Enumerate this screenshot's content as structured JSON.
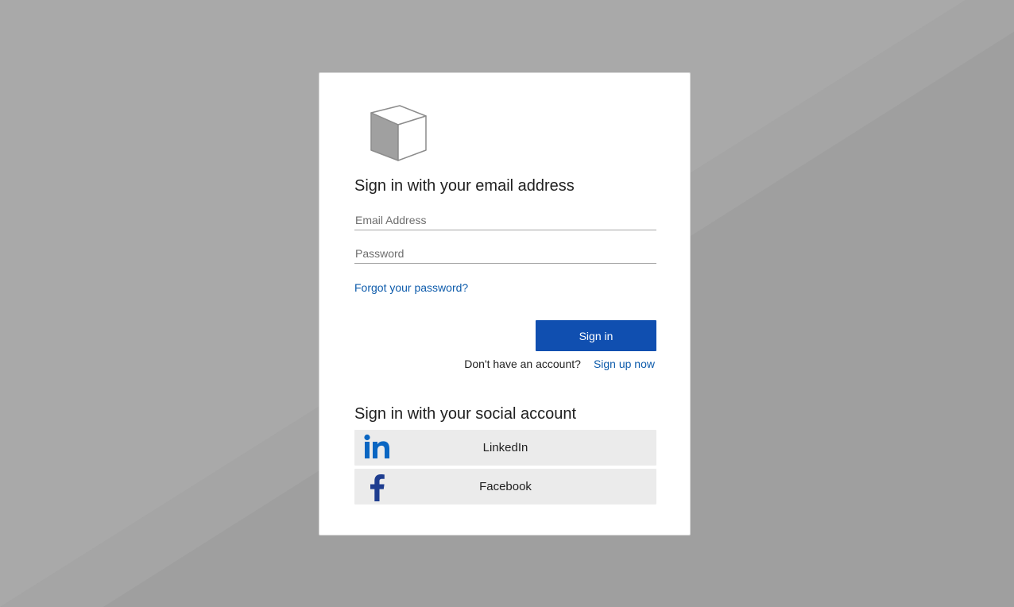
{
  "email_section": {
    "heading": "Sign in with your email address",
    "email_placeholder": "Email Address",
    "email_value": "",
    "password_placeholder": "Password",
    "password_value": "",
    "forgot_label": "Forgot your password?",
    "signin_label": "Sign in",
    "no_account_prompt": "Don't have an account?",
    "signup_label": "Sign up now"
  },
  "social_section": {
    "heading": "Sign in with your social account",
    "providers": [
      {
        "label": "LinkedIn",
        "icon": "linkedin-icon",
        "color": "#0a66c2"
      },
      {
        "label": "Facebook",
        "icon": "facebook-icon",
        "color": "#1e3d8f"
      }
    ]
  },
  "icons": {
    "logo": "cube-logo-icon"
  },
  "colors": {
    "background": "#a1a1a1",
    "primary_button": "#104fb0",
    "link": "#0d5bab",
    "social_button": "#ebebeb"
  }
}
